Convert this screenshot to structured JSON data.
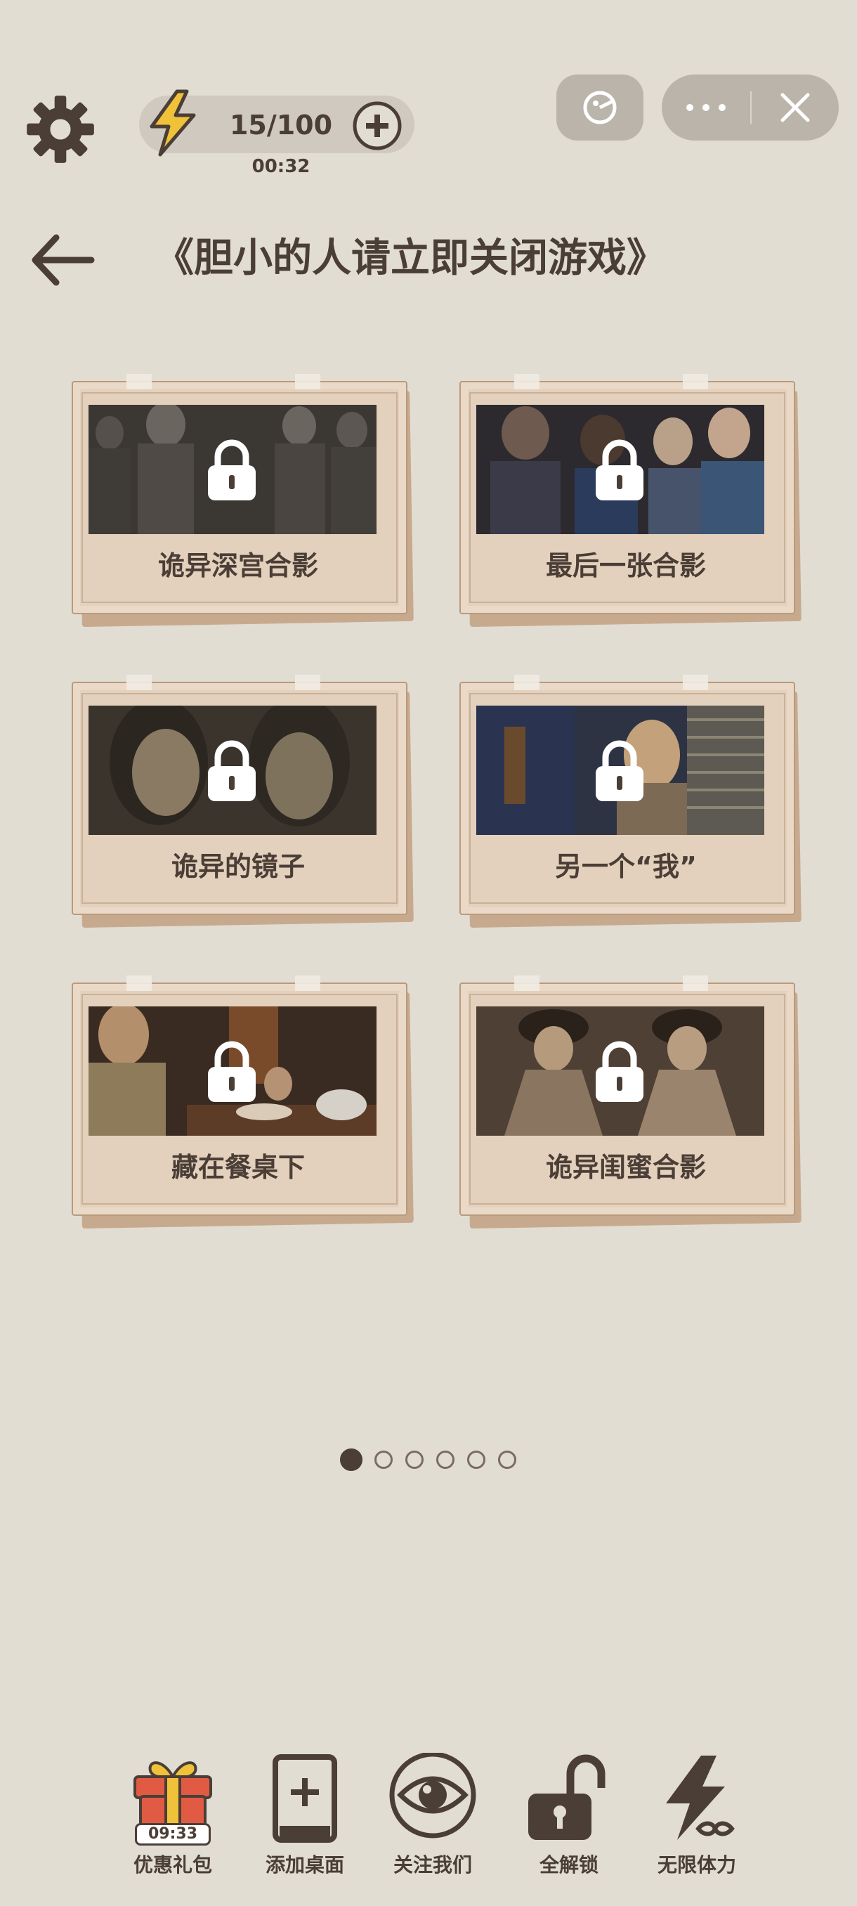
{
  "header": {
    "energy": "15/100",
    "timer": "00:32"
  },
  "title": "《胆小的人请立即关闭游戏》",
  "levels": [
    {
      "label": "诡异深宫合影",
      "locked": true
    },
    {
      "label": "最后一张合影",
      "locked": true
    },
    {
      "label": "诡异的镜子",
      "locked": true
    },
    {
      "label": "另一个“我”",
      "locked": true
    },
    {
      "label": "藏在餐桌下",
      "locked": true
    },
    {
      "label": "诡异闺蜜合影",
      "locked": true
    }
  ],
  "pagination": {
    "total": 6,
    "current": 1
  },
  "bottom_bar": {
    "gift": {
      "label": "优惠礼包",
      "timer": "09:33"
    },
    "add_desktop": {
      "label": "添加桌面"
    },
    "follow": {
      "label": "关注我们"
    },
    "unlock_all": {
      "label": "全解锁"
    },
    "unlimited": {
      "label": "无限体力"
    }
  },
  "colors": {
    "background": "#e2ddd3",
    "text": "#4a3e36",
    "card_paper": "#e3d1bd",
    "accent_yellow": "#f0c23a",
    "accent_red": "#e05a44"
  }
}
